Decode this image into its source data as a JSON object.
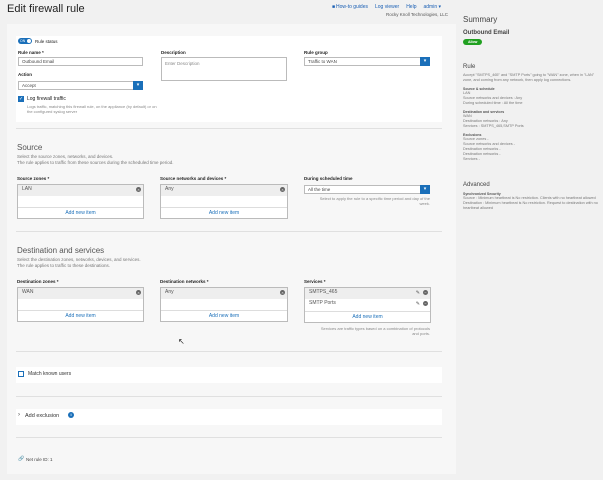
{
  "page": {
    "title": "Edit firewall rule",
    "links": [
      {
        "label": "How-to guides"
      },
      {
        "label": "Log viewer"
      },
      {
        "label": "Help"
      },
      {
        "label": "admin ▾"
      }
    ],
    "company": "Rocky Knoll Technologies, LLC"
  },
  "rule": {
    "status_label": "Rule status",
    "toggle_text": "ON",
    "name_label": "Rule name *",
    "name_value": "Outbound Email",
    "description_label": "Description",
    "description_placeholder": "Enter Description",
    "group_label": "Rule group",
    "group_value": "Traffic to WAN",
    "action_label": "Action",
    "action_value": "Accept",
    "log_label": "Log firewall traffic",
    "log_hint": "Logs traffic, matching this firewall rule, on the appliance (by default) or on the configured syslog server"
  },
  "source": {
    "heading": "Source",
    "sub1": "Select the source zones, networks, and devices.",
    "sub2": "The rule applies to traffic from these sources during the scheduled time period.",
    "zones_label": "Source zones *",
    "zones": [
      "LAN"
    ],
    "networks_label": "Source networks and devices *",
    "networks": [
      "Any"
    ],
    "schedule_label": "During scheduled time",
    "schedule_value": "All the time",
    "schedule_hint": "Select to apply the rule to a specific time period and day of the week.",
    "add_new": "Add new item"
  },
  "destination": {
    "heading": "Destination and services",
    "sub1": "Select the destination zones, networks, devices, and services.",
    "sub2": "The rule applies to traffic to these destinations.",
    "zones_label": "Destination zones *",
    "zones": [
      "WAN"
    ],
    "networks_label": "Destination networks *",
    "networks": [
      "Any"
    ],
    "services_label": "Services *",
    "services": [
      "SMTPS_465",
      "SMTP Ports"
    ],
    "services_hint": "Services are traffic types based on a combination of protocols and ports.",
    "add_new": "Add new item"
  },
  "match_known_users": "Match known users",
  "add_exclusion": "Add exclusion",
  "net_rule_id": "Net rule ID: 1",
  "summary": {
    "title": "Summary",
    "name": "Outbound Email",
    "badge": "Allow",
    "rule_heading": "Rule",
    "rule_text": "Accept \"SMTPS_465\" and \"SMTP Ports\" going to \"WAN\" zone, when in \"LAN\" zone, and coming from any network, then apply log connections.",
    "src_heading": "Source & schedule",
    "src_lines": [
      "LAN",
      "Source networks and devices : Any",
      "During scheduled time : All the time"
    ],
    "dst_heading": "Destination and services",
    "dst_lines": [
      "WAN",
      "Destination networks : Any",
      "Services : SMTPS_465,SMTP Ports"
    ],
    "exc_heading": "Exclusions",
    "exc_lines": [
      "Source zones -",
      "Source networks and devices -",
      "Destination networks -",
      "Destination networks -",
      "Services -"
    ],
    "adv_heading": "Advanced",
    "sync_heading": "Synchronized Security",
    "sync_lines": [
      "Source : Minimum heartbeat is No restriction. Clients with no heartbeat allowed",
      "Destination : Minimum heartbeat is No restriction. Request to destination with no heartbeat allowed"
    ]
  },
  "colors": {
    "accent": "#1a6fb9",
    "allow": "#20a020"
  }
}
